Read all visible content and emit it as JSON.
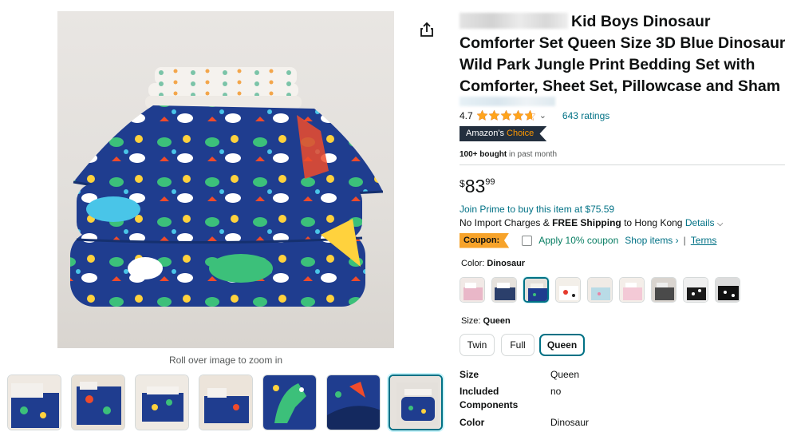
{
  "product": {
    "title_suffix": "Kid Boys Dinosaur Comforter Set Queen Size 3D Blue Dinosaur Wild Park Jungle Print Bedding Set with Comforter, Sheet Set, Pillowcase and Sham",
    "rating": "4.7",
    "rating_value": 4.7,
    "ratings_count": "643 ratings",
    "badge_prefix": "Amazon's",
    "badge_choice": "Choice",
    "bought_bold": "100+ bought",
    "bought_rest": "in past month",
    "price_symbol": "$",
    "price_whole": "83",
    "price_fraction": "99",
    "prime_text": "Join Prime to buy this item at $75.59",
    "shipping_prefix": "No Import Charges &",
    "shipping_bold": "FREE Shipping",
    "shipping_dest": "to Hong Kong",
    "shipping_details": "Details",
    "coupon_tag": "Coupon:",
    "coupon_text": "Apply 10% coupon",
    "shop_items": "Shop items ›",
    "coupon_sep": "|",
    "terms": "Terms",
    "color_label": "Color:",
    "color_value": "Dinosaur",
    "size_label": "Size:",
    "size_value": "Queen",
    "sizes": [
      "Twin",
      "Full",
      "Queen"
    ],
    "zoom_hint": "Roll over image to zoom in"
  },
  "specs": [
    {
      "key": "Size",
      "value": "Queen"
    },
    {
      "key": "Included Components",
      "value": "no"
    },
    {
      "key": "Color",
      "value": "Dinosaur"
    }
  ],
  "colors": {
    "accent": "#007185",
    "badge_bg": "#232f3e",
    "badge_choice": "#ff9900",
    "coupon_bg": "#f7a32a",
    "star": "#ffa41c",
    "coupon_text": "#067d62"
  },
  "icons": {
    "share": "share-icon",
    "star": "star-icon",
    "chevron": "chevron-down-icon"
  }
}
